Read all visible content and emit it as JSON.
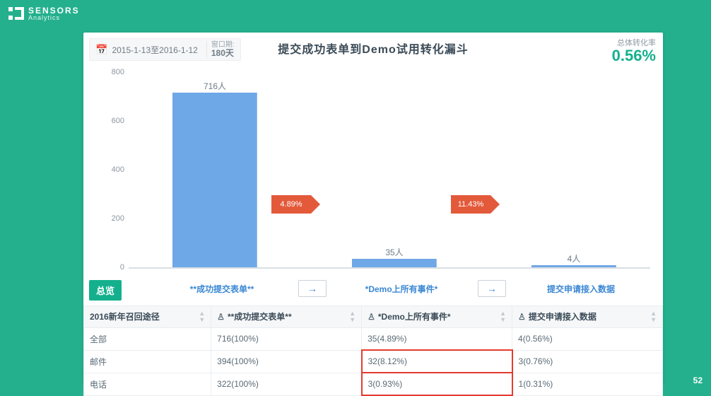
{
  "brand": {
    "line1": "SENSORS",
    "line2": "Analytics"
  },
  "slide_number": "52",
  "header": {
    "date_range": "2015-1-13至2016-1-12",
    "window_label": "窗口期:",
    "window_value": "180天",
    "title": "提交成功表单到Demo试用转化漏斗",
    "rate_label": "总体转化率",
    "rate_value": "0.56%"
  },
  "chart_data": {
    "type": "bar",
    "categories": [
      "**成功提交表单**",
      "*Demo上所有事件*",
      "提交申请接入数据"
    ],
    "values": [
      716,
      35,
      4
    ],
    "value_labels": [
      "716人",
      "35人",
      "4人"
    ],
    "ylabel": "",
    "ylim": [
      0,
      800
    ],
    "yticks": [
      0,
      200,
      400,
      600,
      800
    ],
    "conversion_flags": [
      {
        "between": [
          0,
          1
        ],
        "label": "4.89%"
      },
      {
        "between": [
          1,
          2
        ],
        "label": "11.43%"
      }
    ]
  },
  "steps": {
    "badge": "总览",
    "arrow": "→"
  },
  "table": {
    "headers": [
      "2016新年召回途径",
      "**成功提交表单**",
      "*Demo上所有事件*",
      "提交申请接入数据"
    ],
    "rows": [
      {
        "label": "全部",
        "c1": "716(100%)",
        "c2": "35(4.89%)",
        "c3": "4(0.56%)"
      },
      {
        "label": "邮件",
        "c1": "394(100%)",
        "c2": "32(8.12%)",
        "c3": "3(0.76%)"
      },
      {
        "label": "电话",
        "c1": "322(100%)",
        "c2": "3(0.93%)",
        "c3": "1(0.31%)"
      }
    ]
  }
}
